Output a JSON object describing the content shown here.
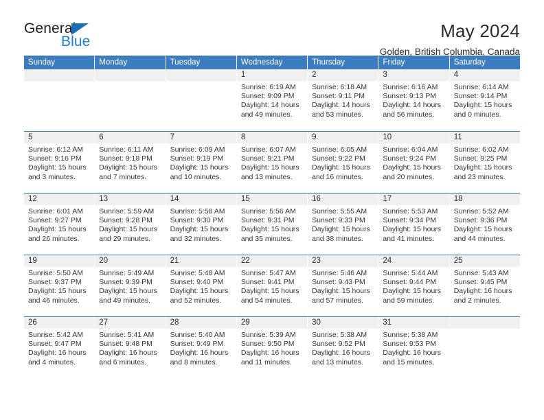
{
  "brand": {
    "name_part1": "General",
    "name_part2": "Blue",
    "triangle_icon": "triangle-icon",
    "color_dark": "#231f20",
    "color_blue": "#1a7fd4"
  },
  "header": {
    "title": "May 2024",
    "subtitle": "Golden, British Columbia, Canada"
  },
  "theme": {
    "header_bg": "#3b7dc0",
    "header_text": "#ffffff",
    "daynum_bg": "#f0f0f0",
    "body_text": "#333333"
  },
  "calendar": {
    "weekday_headers": [
      "Sunday",
      "Monday",
      "Tuesday",
      "Wednesday",
      "Thursday",
      "Friday",
      "Saturday"
    ],
    "weeks": [
      [
        {
          "day": "",
          "sunrise": "",
          "sunset": "",
          "daylight_line1": "",
          "daylight_line2": ""
        },
        {
          "day": "",
          "sunrise": "",
          "sunset": "",
          "daylight_line1": "",
          "daylight_line2": ""
        },
        {
          "day": "",
          "sunrise": "",
          "sunset": "",
          "daylight_line1": "",
          "daylight_line2": ""
        },
        {
          "day": "1",
          "sunrise": "Sunrise: 6:19 AM",
          "sunset": "Sunset: 9:09 PM",
          "daylight_line1": "Daylight: 14 hours",
          "daylight_line2": "and 49 minutes."
        },
        {
          "day": "2",
          "sunrise": "Sunrise: 6:18 AM",
          "sunset": "Sunset: 9:11 PM",
          "daylight_line1": "Daylight: 14 hours",
          "daylight_line2": "and 53 minutes."
        },
        {
          "day": "3",
          "sunrise": "Sunrise: 6:16 AM",
          "sunset": "Sunset: 9:13 PM",
          "daylight_line1": "Daylight: 14 hours",
          "daylight_line2": "and 56 minutes."
        },
        {
          "day": "4",
          "sunrise": "Sunrise: 6:14 AM",
          "sunset": "Sunset: 9:14 PM",
          "daylight_line1": "Daylight: 15 hours",
          "daylight_line2": "and 0 minutes."
        }
      ],
      [
        {
          "day": "5",
          "sunrise": "Sunrise: 6:12 AM",
          "sunset": "Sunset: 9:16 PM",
          "daylight_line1": "Daylight: 15 hours",
          "daylight_line2": "and 3 minutes."
        },
        {
          "day": "6",
          "sunrise": "Sunrise: 6:11 AM",
          "sunset": "Sunset: 9:18 PM",
          "daylight_line1": "Daylight: 15 hours",
          "daylight_line2": "and 7 minutes."
        },
        {
          "day": "7",
          "sunrise": "Sunrise: 6:09 AM",
          "sunset": "Sunset: 9:19 PM",
          "daylight_line1": "Daylight: 15 hours",
          "daylight_line2": "and 10 minutes."
        },
        {
          "day": "8",
          "sunrise": "Sunrise: 6:07 AM",
          "sunset": "Sunset: 9:21 PM",
          "daylight_line1": "Daylight: 15 hours",
          "daylight_line2": "and 13 minutes."
        },
        {
          "day": "9",
          "sunrise": "Sunrise: 6:05 AM",
          "sunset": "Sunset: 9:22 PM",
          "daylight_line1": "Daylight: 15 hours",
          "daylight_line2": "and 16 minutes."
        },
        {
          "day": "10",
          "sunrise": "Sunrise: 6:04 AM",
          "sunset": "Sunset: 9:24 PM",
          "daylight_line1": "Daylight: 15 hours",
          "daylight_line2": "and 20 minutes."
        },
        {
          "day": "11",
          "sunrise": "Sunrise: 6:02 AM",
          "sunset": "Sunset: 9:25 PM",
          "daylight_line1": "Daylight: 15 hours",
          "daylight_line2": "and 23 minutes."
        }
      ],
      [
        {
          "day": "12",
          "sunrise": "Sunrise: 6:01 AM",
          "sunset": "Sunset: 9:27 PM",
          "daylight_line1": "Daylight: 15 hours",
          "daylight_line2": "and 26 minutes."
        },
        {
          "day": "13",
          "sunrise": "Sunrise: 5:59 AM",
          "sunset": "Sunset: 9:28 PM",
          "daylight_line1": "Daylight: 15 hours",
          "daylight_line2": "and 29 minutes."
        },
        {
          "day": "14",
          "sunrise": "Sunrise: 5:58 AM",
          "sunset": "Sunset: 9:30 PM",
          "daylight_line1": "Daylight: 15 hours",
          "daylight_line2": "and 32 minutes."
        },
        {
          "day": "15",
          "sunrise": "Sunrise: 5:56 AM",
          "sunset": "Sunset: 9:31 PM",
          "daylight_line1": "Daylight: 15 hours",
          "daylight_line2": "and 35 minutes."
        },
        {
          "day": "16",
          "sunrise": "Sunrise: 5:55 AM",
          "sunset": "Sunset: 9:33 PM",
          "daylight_line1": "Daylight: 15 hours",
          "daylight_line2": "and 38 minutes."
        },
        {
          "day": "17",
          "sunrise": "Sunrise: 5:53 AM",
          "sunset": "Sunset: 9:34 PM",
          "daylight_line1": "Daylight: 15 hours",
          "daylight_line2": "and 41 minutes."
        },
        {
          "day": "18",
          "sunrise": "Sunrise: 5:52 AM",
          "sunset": "Sunset: 9:36 PM",
          "daylight_line1": "Daylight: 15 hours",
          "daylight_line2": "and 44 minutes."
        }
      ],
      [
        {
          "day": "19",
          "sunrise": "Sunrise: 5:50 AM",
          "sunset": "Sunset: 9:37 PM",
          "daylight_line1": "Daylight: 15 hours",
          "daylight_line2": "and 46 minutes."
        },
        {
          "day": "20",
          "sunrise": "Sunrise: 5:49 AM",
          "sunset": "Sunset: 9:39 PM",
          "daylight_line1": "Daylight: 15 hours",
          "daylight_line2": "and 49 minutes."
        },
        {
          "day": "21",
          "sunrise": "Sunrise: 5:48 AM",
          "sunset": "Sunset: 9:40 PM",
          "daylight_line1": "Daylight: 15 hours",
          "daylight_line2": "and 52 minutes."
        },
        {
          "day": "22",
          "sunrise": "Sunrise: 5:47 AM",
          "sunset": "Sunset: 9:41 PM",
          "daylight_line1": "Daylight: 15 hours",
          "daylight_line2": "and 54 minutes."
        },
        {
          "day": "23",
          "sunrise": "Sunrise: 5:46 AM",
          "sunset": "Sunset: 9:43 PM",
          "daylight_line1": "Daylight: 15 hours",
          "daylight_line2": "and 57 minutes."
        },
        {
          "day": "24",
          "sunrise": "Sunrise: 5:44 AM",
          "sunset": "Sunset: 9:44 PM",
          "daylight_line1": "Daylight: 15 hours",
          "daylight_line2": "and 59 minutes."
        },
        {
          "day": "25",
          "sunrise": "Sunrise: 5:43 AM",
          "sunset": "Sunset: 9:45 PM",
          "daylight_line1": "Daylight: 16 hours",
          "daylight_line2": "and 2 minutes."
        }
      ],
      [
        {
          "day": "26",
          "sunrise": "Sunrise: 5:42 AM",
          "sunset": "Sunset: 9:47 PM",
          "daylight_line1": "Daylight: 16 hours",
          "daylight_line2": "and 4 minutes."
        },
        {
          "day": "27",
          "sunrise": "Sunrise: 5:41 AM",
          "sunset": "Sunset: 9:48 PM",
          "daylight_line1": "Daylight: 16 hours",
          "daylight_line2": "and 6 minutes."
        },
        {
          "day": "28",
          "sunrise": "Sunrise: 5:40 AM",
          "sunset": "Sunset: 9:49 PM",
          "daylight_line1": "Daylight: 16 hours",
          "daylight_line2": "and 8 minutes."
        },
        {
          "day": "29",
          "sunrise": "Sunrise: 5:39 AM",
          "sunset": "Sunset: 9:50 PM",
          "daylight_line1": "Daylight: 16 hours",
          "daylight_line2": "and 11 minutes."
        },
        {
          "day": "30",
          "sunrise": "Sunrise: 5:38 AM",
          "sunset": "Sunset: 9:52 PM",
          "daylight_line1": "Daylight: 16 hours",
          "daylight_line2": "and 13 minutes."
        },
        {
          "day": "31",
          "sunrise": "Sunrise: 5:38 AM",
          "sunset": "Sunset: 9:53 PM",
          "daylight_line1": "Daylight: 16 hours",
          "daylight_line2": "and 15 minutes."
        },
        {
          "day": "",
          "sunrise": "",
          "sunset": "",
          "daylight_line1": "",
          "daylight_line2": ""
        }
      ]
    ]
  }
}
